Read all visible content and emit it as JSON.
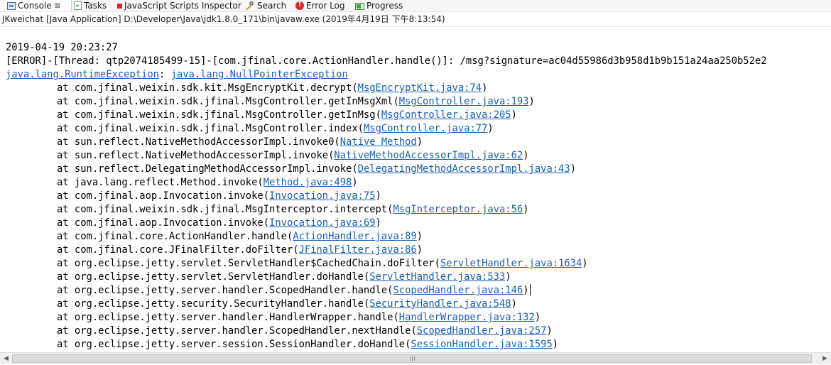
{
  "tabs": [
    {
      "label": "Console",
      "icon": "console-icon",
      "active": true,
      "close_glyph": "⊠"
    },
    {
      "label": "Tasks",
      "icon": "tasks-icon"
    },
    {
      "label": "JavaScript Scripts Inspector",
      "icon": "javascript-inspector-icon"
    },
    {
      "label": "Search",
      "icon": "search-icon"
    },
    {
      "label": "Error Log",
      "icon": "error-log-icon"
    },
    {
      "label": "Progress",
      "icon": "progress-icon"
    }
  ],
  "process_info": "JKweichat [Java Application] D:\\Developer\\Java\\jdk1.8.0_171\\bin\\javaw.exe (2019年4月19日 下午8:13:54)",
  "console": {
    "timestamp": "2019-04-19 20:23:27",
    "error_line": "[ERROR]-[Thread: qtp2074185499-15]-[com.jfinal.core.ActionHandler.handle()]: /msg?signature=ac04d55986d3b958d1b9b151a24aa250b52e2",
    "exception": {
      "primary": "java.lang.RuntimeException",
      "separator": ": ",
      "cause": "java.lang.NullPointerException"
    },
    "stack": [
      {
        "method": "at com.jfinal.weixin.sdk.kit.MsgEncryptKit.decrypt",
        "source": "MsgEncryptKit.java:74"
      },
      {
        "method": "at com.jfinal.weixin.sdk.jfinal.MsgController.getInMsgXml",
        "source": "MsgController.java:193"
      },
      {
        "method": "at com.jfinal.weixin.sdk.jfinal.MsgController.getInMsg",
        "source": "MsgController.java:205"
      },
      {
        "method": "at com.jfinal.weixin.sdk.jfinal.MsgController.index",
        "source": "MsgController.java:77"
      },
      {
        "method": "at sun.reflect.NativeMethodAccessorImpl.invoke0",
        "source": "Native Method"
      },
      {
        "method": "at sun.reflect.NativeMethodAccessorImpl.invoke",
        "source": "NativeMethodAccessorImpl.java:62"
      },
      {
        "method": "at sun.reflect.DelegatingMethodAccessorImpl.invoke",
        "source": "DelegatingMethodAccessorImpl.java:43"
      },
      {
        "method": "at java.lang.reflect.Method.invoke",
        "source": "Method.java:498"
      },
      {
        "method": "at com.jfinal.aop.Invocation.invoke",
        "source": "Invocation.java:75"
      },
      {
        "method": "at com.jfinal.weixin.sdk.jfinal.MsgInterceptor.intercept",
        "source": "MsgInterceptor.java:56"
      },
      {
        "method": "at com.jfinal.aop.Invocation.invoke",
        "source": "Invocation.java:69"
      },
      {
        "method": "at com.jfinal.core.ActionHandler.handle",
        "source": "ActionHandler.java:89"
      },
      {
        "method": "at com.jfinal.core.JFinalFilter.doFilter",
        "source": "JFinalFilter.java:86"
      },
      {
        "method": "at org.eclipse.jetty.servlet.ServletHandler$CachedChain.doFilter",
        "source": "ServletHandler.java:1634"
      },
      {
        "method": "at org.eclipse.jetty.servlet.ServletHandler.doHandle",
        "source": "ServletHandler.java:533"
      },
      {
        "method": "at org.eclipse.jetty.server.handler.ScopedHandler.handle",
        "source": "ScopedHandler.java:146"
      },
      {
        "method": "at org.eclipse.jetty.security.SecurityHandler.handle",
        "source": "SecurityHandler.java:548"
      },
      {
        "method": "at org.eclipse.jetty.server.handler.HandlerWrapper.handle",
        "source": "HandlerWrapper.java:132"
      },
      {
        "method": "at org.eclipse.jetty.server.handler.ScopedHandler.nextHandle",
        "source": "ScopedHandler.java:257"
      },
      {
        "method": "at org.eclipse.jetty.server.session.SessionHandler.doHandle",
        "source": "SessionHandler.java:1595"
      }
    ],
    "caret_after_row": 15
  },
  "scrollbar": {
    "left_arrow": "◀",
    "right_arrow": "▶"
  },
  "colors": {
    "link": "#1a5fb4",
    "error_icon": "#d62a2a",
    "js_inspector_icon": "#e02020"
  }
}
